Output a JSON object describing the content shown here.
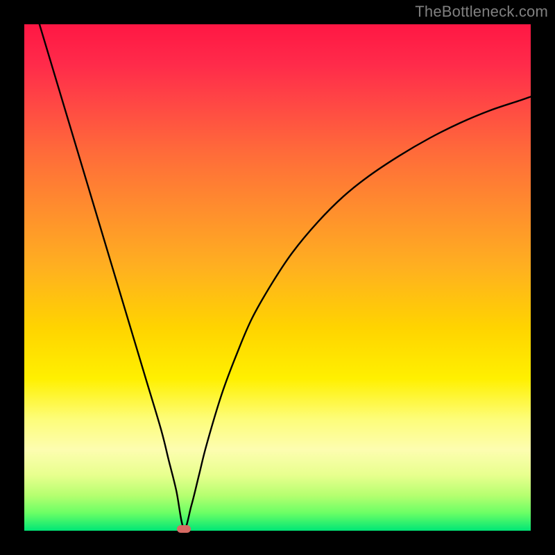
{
  "watermark": "TheBottleneck.com",
  "colors": {
    "frame": "#000000",
    "curve": "#000000",
    "marker": "#d66a63",
    "watermark": "#808080"
  },
  "chart_data": {
    "type": "line",
    "title": "",
    "xlabel": "",
    "ylabel": "",
    "xlim": [
      0,
      100
    ],
    "ylim": [
      0,
      100
    ],
    "annotations": [
      {
        "name": "optimal-marker",
        "x": 31.5,
        "y": 0
      }
    ],
    "series": [
      {
        "name": "bottleneck-curve",
        "x": [
          3,
          6,
          9,
          12,
          15,
          18,
          21,
          24,
          27,
          28.5,
          30,
          31.5,
          33,
          34.5,
          36,
          39,
          42,
          45,
          49,
          53,
          58,
          63,
          68,
          74,
          80,
          86,
          92,
          98,
          100
        ],
        "y": [
          100,
          90,
          80,
          70,
          60,
          50,
          40,
          30,
          20,
          14,
          8,
          0.5,
          5,
          11,
          17,
          27,
          35,
          42,
          49,
          55,
          61,
          66,
          70,
          74,
          77.5,
          80.5,
          83,
          85,
          85.7
        ]
      }
    ]
  }
}
